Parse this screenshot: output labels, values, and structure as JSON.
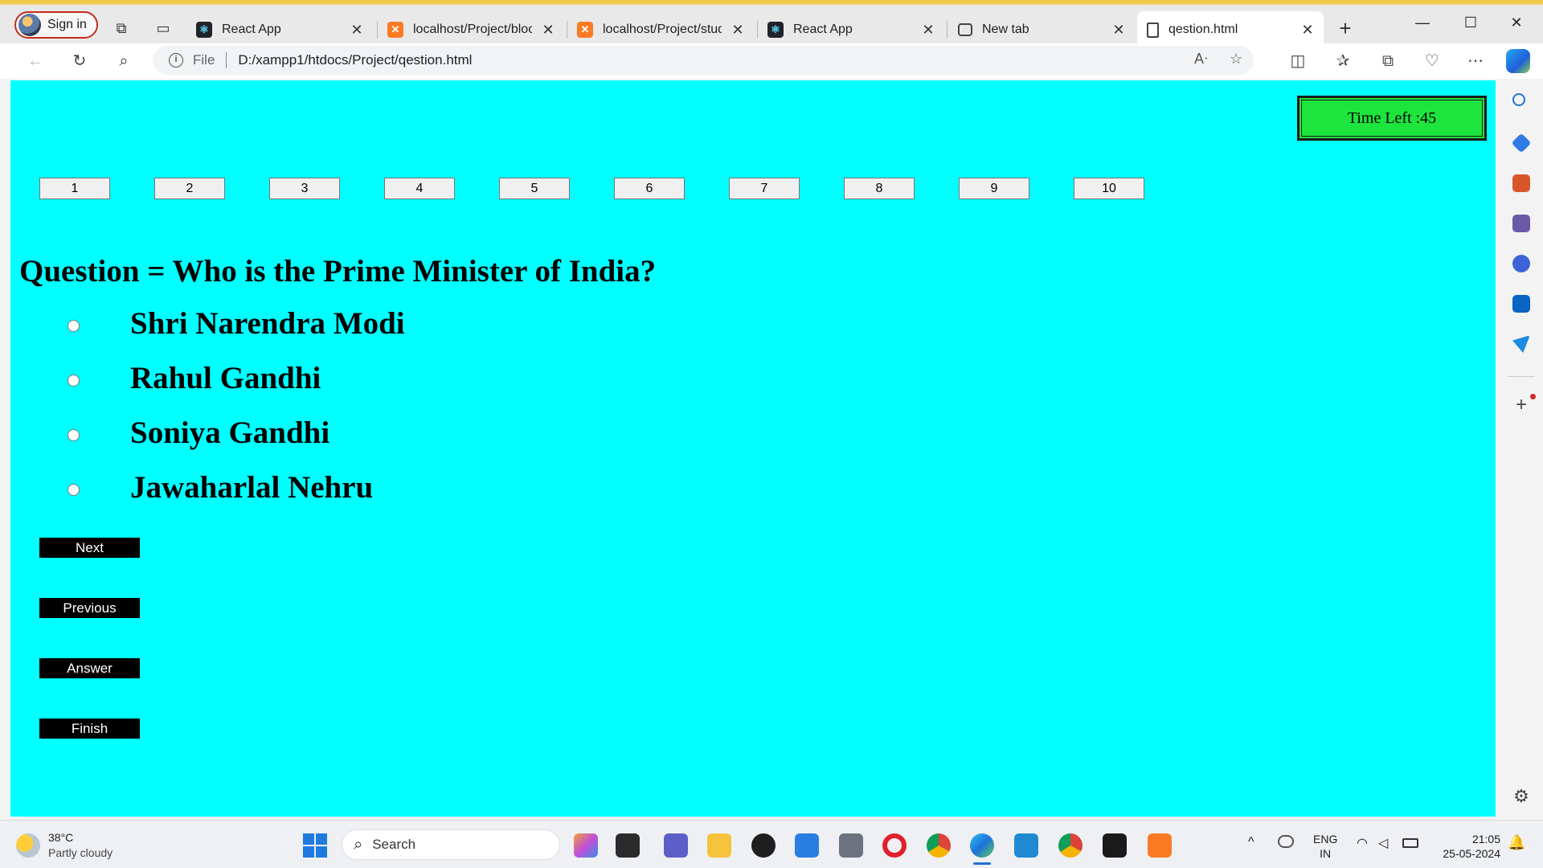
{
  "browser": {
    "profile_label": "Sign in",
    "tabs": [
      {
        "title": "React App",
        "icon": "react-icon"
      },
      {
        "title": "localhost/Project/blood",
        "icon": "xampp-icon"
      },
      {
        "title": "localhost/Project/stude",
        "icon": "xampp-icon"
      },
      {
        "title": "React App",
        "icon": "react-icon"
      },
      {
        "title": "New tab",
        "icon": "new-tab-icon"
      },
      {
        "title": "qestion.html",
        "icon": "page-icon"
      }
    ],
    "address": {
      "protocol": "File",
      "url": "D:/xampp1/htdocs/Project/qestion.html"
    }
  },
  "page": {
    "timer": "Time Left :45",
    "question_numbers": [
      "1",
      "2",
      "3",
      "4",
      "5",
      "6",
      "7",
      "8",
      "9",
      "10"
    ],
    "question": "Question = Who is the Prime Minister of India?",
    "options": [
      "Shri Narendra Modi",
      "Rahul Gandhi",
      "Soniya Gandhi",
      "Jawaharlal Nehru"
    ],
    "buttons": {
      "next": "Next",
      "previous": "Previous",
      "answer": "Answer",
      "finish": "Finish"
    },
    "colors": {
      "background": "#00ffff",
      "timer": "#1ee53d",
      "buttons": "#000000"
    }
  },
  "taskbar": {
    "weather": {
      "temp": "38°C",
      "condition": "Partly cloudy"
    },
    "search_label": "Search",
    "language": {
      "line1": "ENG",
      "line2": "IN"
    },
    "clock": {
      "time": "21:05",
      "date": "25-05-2024"
    }
  }
}
